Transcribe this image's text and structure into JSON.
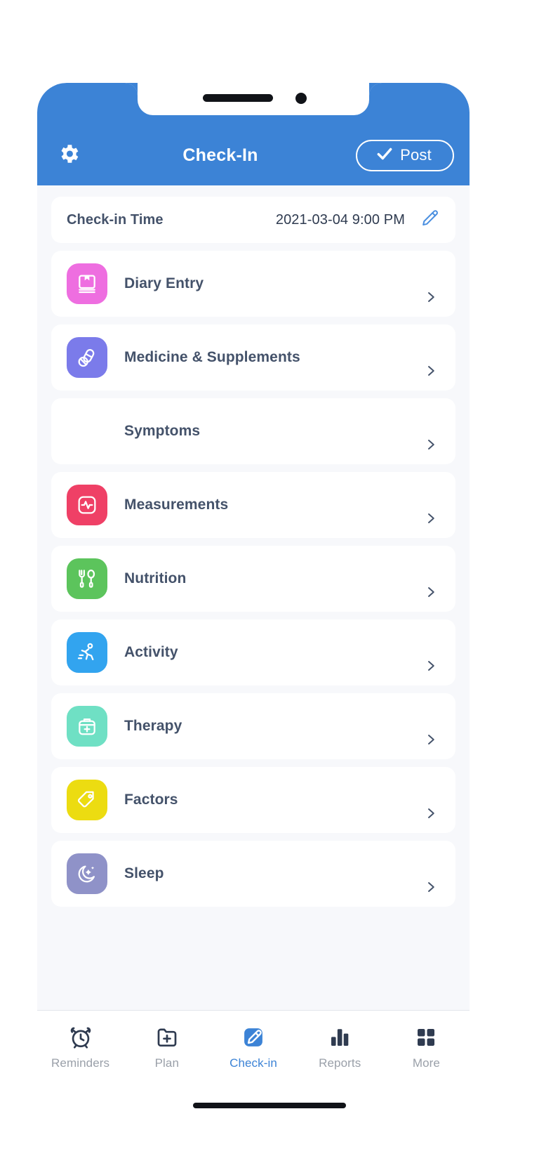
{
  "header": {
    "title": "Check-In",
    "gear_icon": "gear-icon",
    "post_label": "Post",
    "post_icon": "check-icon",
    "background_color": "#3c83d6"
  },
  "check_in_time": {
    "label": "Check-in Time",
    "value": "2021-03-04 9:00 PM",
    "edit_icon": "pencil-icon"
  },
  "rows": [
    {
      "label": "Diary Entry",
      "icon": "diary-icon",
      "color": "#ee6ee0",
      "chevron": "chevron-right-icon"
    },
    {
      "label": "Medicine & Supplements",
      "icon": "pills-icon",
      "color": "#7b7bea",
      "chevron": "chevron-right-icon"
    },
    {
      "label": "Symptoms",
      "icon": "symptoms-icon",
      "color": "#f5a košt"
    },
    {
      "label": "Measurements",
      "icon": "heartbeat-icon",
      "color": "#ef4066",
      "chevron": "chevron-right-icon"
    },
    {
      "label": "Nutrition",
      "icon": "cutlery-icon",
      "color": "#5cc45c",
      "chevron": "chevron-right-icon"
    },
    {
      "label": "Activity",
      "icon": "running-icon",
      "color": "#32a4ef",
      "chevron": "chevron-right-icon"
    },
    {
      "label": "Therapy",
      "icon": "medkit-icon",
      "color": "#6fe0c4",
      "chevron": "chevron-right-icon"
    },
    {
      "label": "Factors",
      "icon": "tag-icon",
      "color": "#ecdc11",
      "chevron": "chevron-right-icon"
    },
    {
      "label": "Sleep",
      "icon": "moon-stars-icon",
      "color": "#8f92c8",
      "chevron": "chevron-right-icon"
    }
  ],
  "tabs": [
    {
      "label": "Reminders",
      "icon": "alarm-clock-icon",
      "active": false
    },
    {
      "label": "Plan",
      "icon": "folder-plus-icon",
      "active": false
    },
    {
      "label": "Check-in",
      "icon": "pencil-square-icon",
      "active": true
    },
    {
      "label": "Reports",
      "icon": "bar-chart-icon",
      "active": false
    },
    {
      "label": "More",
      "icon": "grid-icon",
      "active": false
    }
  ],
  "colors": {
    "accent": "#3c83d6",
    "text_primary": "#44526a",
    "text_muted": "#9aa0a9",
    "page_bg": "#f7f8fb"
  }
}
